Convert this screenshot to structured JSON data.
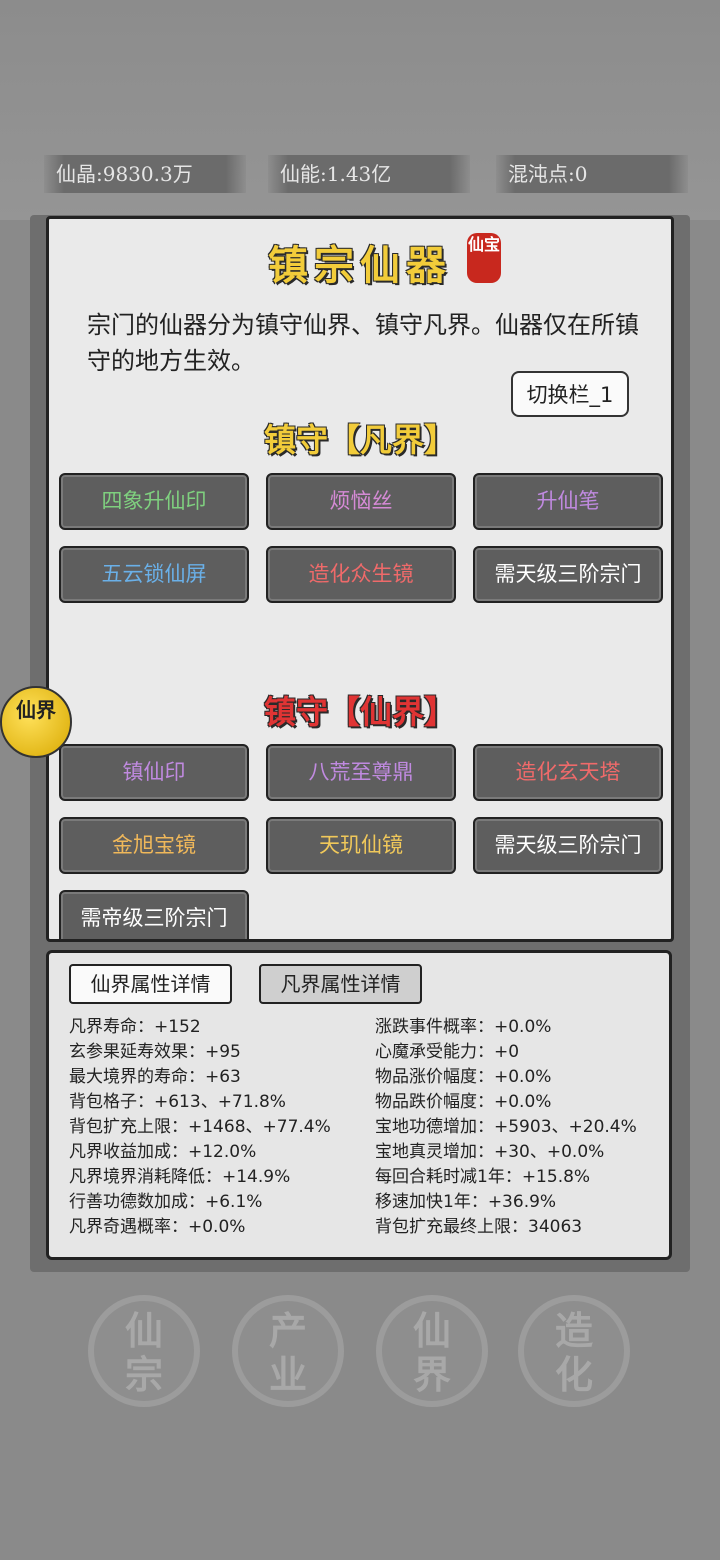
{
  "resources": {
    "crystal": "仙晶:9830.3万",
    "energy": "仙能:1.43亿",
    "chaos": "混沌点:0"
  },
  "panel": {
    "title": "镇宗仙器",
    "seal": "仙宝",
    "description": "宗门的仙器分为镇守仙界、镇守凡界。仙器仅在所镇守的地方生效。",
    "switch_label": "切换栏_1"
  },
  "mortal": {
    "title": "镇守【凡界】",
    "items": [
      {
        "label": "四象升仙印",
        "color": "#7fd07f"
      },
      {
        "label": "烦恼丝",
        "color": "#d58ad5"
      },
      {
        "label": "升仙笔",
        "color": "#c08ae0"
      },
      {
        "label": "五云锁仙屏",
        "color": "#6ab0e8"
      },
      {
        "label": "造化众生镜",
        "color": "#ef6a6a"
      },
      {
        "label": "需天级三阶宗门",
        "color": "#ffffff"
      }
    ]
  },
  "immortal": {
    "title": "镇守【仙界】",
    "items": [
      {
        "label": "镇仙印",
        "color": "#c08ae0"
      },
      {
        "label": "八荒至尊鼎",
        "color": "#c08ae0"
      },
      {
        "label": "造化玄天塔",
        "color": "#ef6a6a"
      },
      {
        "label": "金旭宝镜",
        "color": "#f0b85a"
      },
      {
        "label": "天玑仙镜",
        "color": "#f0c85a"
      },
      {
        "label": "需天级三阶宗门",
        "color": "#ffffff"
      },
      {
        "label": "需帝级三阶宗门",
        "color": "#ffffff"
      }
    ]
  },
  "side_badge": "仙界",
  "attributes": {
    "tab_immortal": "仙界属性详情",
    "tab_mortal": "凡界属性详情",
    "left": [
      "凡界寿命：+152",
      "玄参果延寿效果：+95",
      "最大境界的寿命：+63",
      "背包格子：+613、+71.8%",
      "背包扩充上限：+1468、+77.4%",
      "凡界收益加成：+12.0%",
      "凡界境界消耗降低：+14.9%",
      "行善功德数加成：+6.1%",
      "凡界奇遇概率：+0.0%"
    ],
    "right": [
      "涨跌事件概率：+0.0%",
      "心魔承受能力：+0",
      "物品涨价幅度：+0.0%",
      "物品跌价幅度：+0.0%",
      "宝地功德增加：+5903、+20.4%",
      "宝地真灵增加：+30、+0.0%",
      "每回合耗时减1年：+15.8%",
      "移速加快1年：+36.9%",
      "背包扩充最终上限：34063"
    ]
  },
  "nav": [
    {
      "line1": "仙",
      "line2": "宗"
    },
    {
      "line1": "产",
      "line2": "业"
    },
    {
      "line1": "仙",
      "line2": "界"
    },
    {
      "line1": "造",
      "line2": "化"
    }
  ]
}
